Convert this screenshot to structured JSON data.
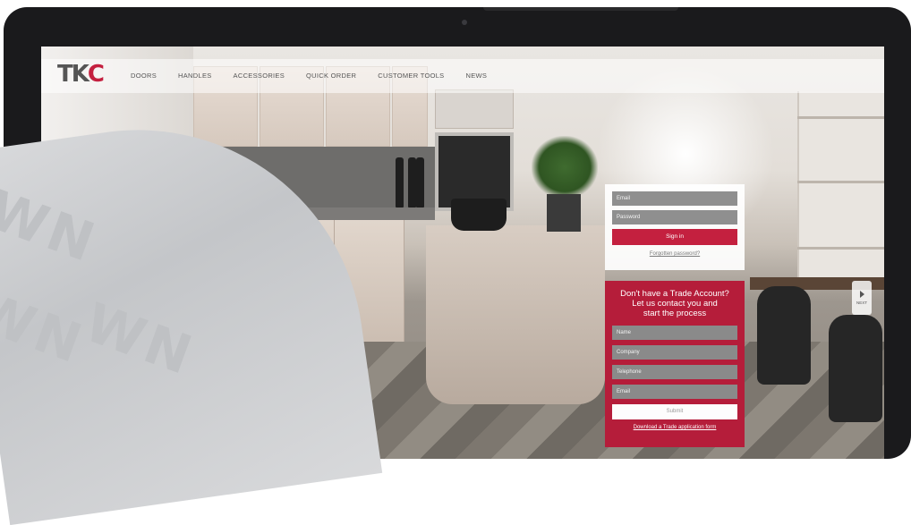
{
  "logo": {
    "part1": "TK",
    "part2": "C"
  },
  "nav": [
    "DOORS",
    "HANDLES",
    "ACCESSORIES",
    "QUICK ORDER",
    "CUSTOMER TOOLS",
    "NEWS"
  ],
  "login": {
    "email_placeholder": "Email",
    "password_placeholder": "Password",
    "signin_label": "Sign in",
    "forgot_label": "Forgotten password?"
  },
  "trade": {
    "heading_line1": "Don't have a Trade Account?",
    "heading_line2": "Let us contact you and",
    "heading_line3": "start the process",
    "name_placeholder": "Name",
    "company_placeholder": "Company",
    "telephone_placeholder": "Telephone",
    "email_placeholder": "Email",
    "submit_label": "Submit",
    "download_label": "Download a Trade application form"
  },
  "next_tab": {
    "label": "NEXT"
  },
  "watermark": "WN",
  "colors": {
    "brand_red": "#c4203f",
    "trade_red": "#b51d3a",
    "field_grey": "#8f8f8f"
  }
}
